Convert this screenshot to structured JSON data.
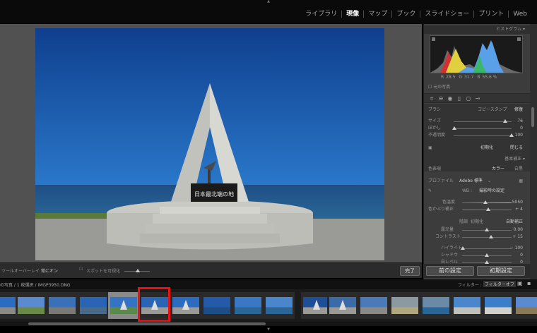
{
  "modules": [
    "ライブラリ",
    "現像",
    "マップ",
    "ブック",
    "スライドショー",
    "プリント",
    "Web"
  ],
  "active_module": "現像",
  "photo": {
    "monument_text": "日本最北端の地",
    "sky_color": "#1c5fb2",
    "sea_color": "#1f4d7a"
  },
  "histogram": {
    "title": "ヒストグラム",
    "r_label": "R",
    "r_value": "28.5",
    "g_label": "G",
    "g_value": "31.7",
    "b_label": "B",
    "b_value": "55.6 %",
    "original_photo_label": "元の写真"
  },
  "brush": {
    "label": "ブラシ",
    "copy_stamp_label": "コピースタンプ",
    "heal_label": "修復",
    "size_label": "サイズ",
    "size_value": "76",
    "feather_label": "ぼかし",
    "feather_value": "0",
    "opacity_label": "不透明度",
    "opacity_value": "100",
    "reset_label": "初期化",
    "close_label": "閉じる"
  },
  "basic": {
    "header": "基本補正",
    "treatment_label": "色表現",
    "color_label": "カラー",
    "bw_label": "白黒",
    "profile_label": "プロファイル",
    "profile_value": "Adobe 標準",
    "wb_label": "WB :",
    "wb_value": "撮影時の設定",
    "temp_label": "色温度",
    "temp_value": "5050",
    "tint_label": "色かぶり補正",
    "tint_value": "+ 4",
    "tone_label": "階調",
    "reset_label": "初期化",
    "auto_label": "自動補正",
    "exposure_label": "露光量",
    "exposure_value": "0.00",
    "contrast_label": "コントラスト",
    "contrast_value": "+ 15",
    "highlights_label": "ハイライト",
    "highlights_value": "− 100",
    "shadows_label": "シャドウ",
    "shadows_value": "0",
    "whites_label": "白レベル",
    "whites_value": "0"
  },
  "toolbar": {
    "overlay_label": "ツールオーバーレイ :",
    "overlay_value": "常にオン",
    "visualize_spots_label": "スポットを可視化",
    "done_label": "完了"
  },
  "bottom_buttons": {
    "previous_label": "前の設定",
    "reset_label": "初期設定"
  },
  "filmbar": {
    "info": "の写真 / 1 枚選択 / IMGP3950.DNG",
    "filter_label": "フィルター :",
    "filter_value": "フィルターオフ"
  },
  "thumbnails_count": 18,
  "selected_thumbnail_index": 4
}
